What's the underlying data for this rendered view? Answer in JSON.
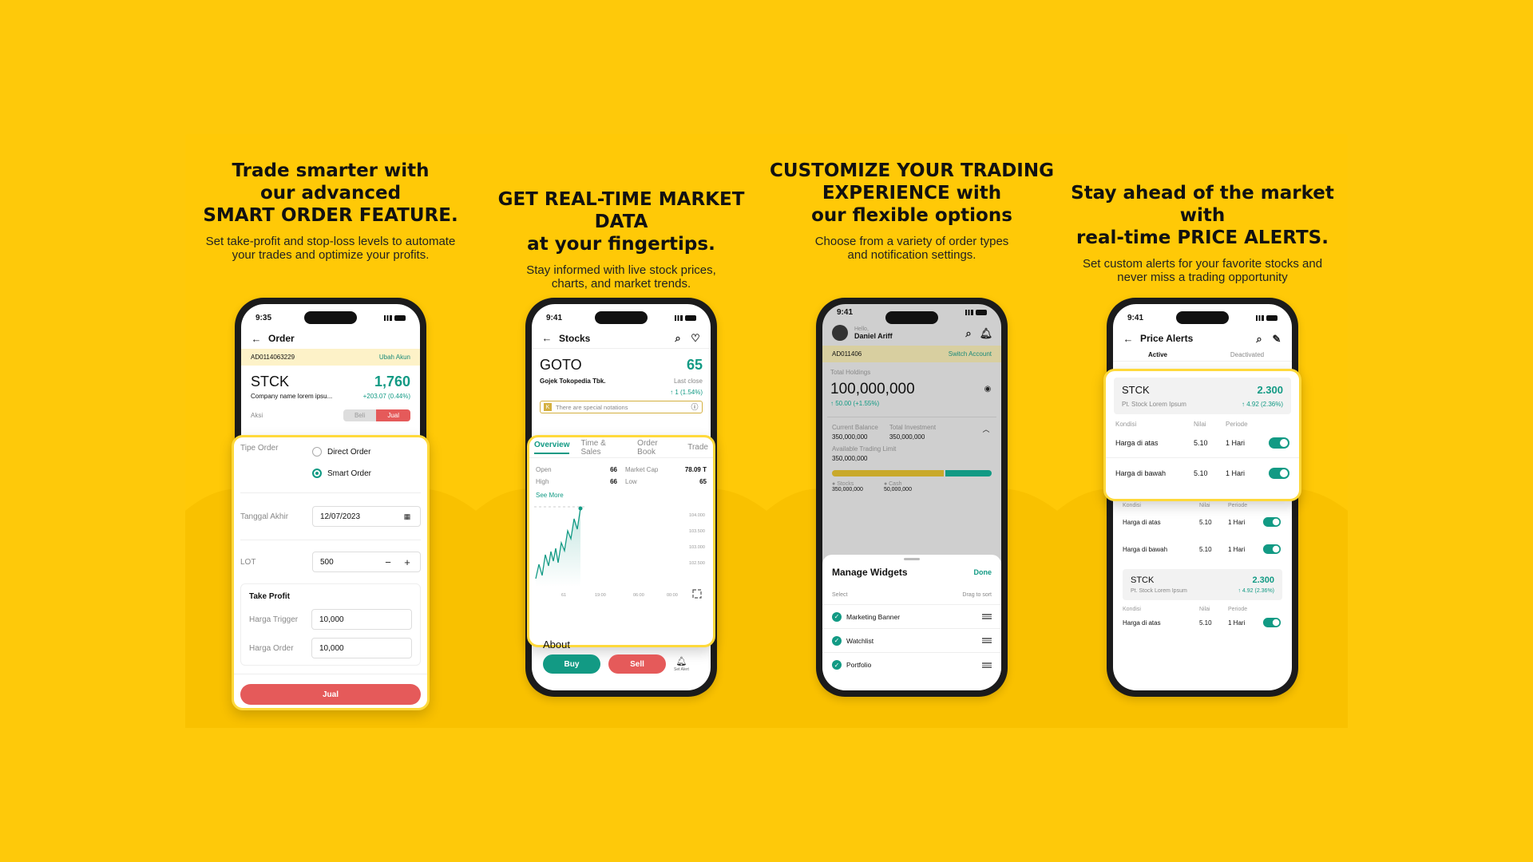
{
  "colors": {
    "background": "#FEC90A",
    "accent_green": "#129a84",
    "sell_red": "#e55a5a",
    "highlight_border": "#FFD93B"
  },
  "panels": [
    {
      "headline": "Trade smarter with\nour advanced\nSMART ORDER FEATURE.",
      "sub": "Set take-profit and stop-loss levels to automate\nyour trades and optimize your profits."
    },
    {
      "headline": "GET REAL-TIME MARKET DATA\nat your fingertips.",
      "sub": "Stay informed with live stock prices,\ncharts, and market trends."
    },
    {
      "headline": "CUSTOMIZE YOUR TRADING\nEXPERIENCE with\nour flexible options",
      "sub": "Choose from a variety of order types\nand notification settings."
    },
    {
      "headline": "Stay ahead of the market with\nreal-time PRICE ALERTS.",
      "sub": "Set custom alerts for your favorite stocks and\nnever miss a trading opportunity"
    }
  ],
  "phone1": {
    "time": "9:35",
    "title": "Order",
    "account": "AD0114063229",
    "change_account": "Ubah Akun",
    "ticker": "STCK",
    "company": "Company name lorem ipsu...",
    "price": "1,760",
    "change": "+203.07 (0.44%)",
    "aksi_label": "Aksi",
    "beli": "Beli",
    "jual": "Jual",
    "tipe_order_label": "Tipe Order",
    "direct_order": "Direct Order",
    "smart_order": "Smart Order",
    "tanggal_label": "Tanggal Akhir",
    "tanggal_value": "12/07/2023",
    "lot_label": "LOT",
    "lot_value": "500",
    "take_profit": "Take Profit",
    "harga_trigger_label": "Harga Trigger",
    "harga_trigger": "10,000",
    "harga_order_label": "Harga Order",
    "harga_order": "10,000",
    "submit": "Jual"
  },
  "phone2": {
    "time": "9:41",
    "title": "Stocks",
    "ticker": "GOTO",
    "company": "Gojek Tokopedia Tbk.",
    "price": "65",
    "last_close": "Last close",
    "change": "↑ 1 (1.54%)",
    "notice": "There are special notations",
    "tabs": [
      "Overview",
      "Time & Sales",
      "Order Book",
      "Trade"
    ],
    "stats": {
      "open_label": "Open",
      "open": "66",
      "high_label": "High",
      "high": "66",
      "mcap_label": "Market Cap",
      "mcap": "78.09 T",
      "low_label": "Low",
      "low": "65"
    },
    "see_more": "See More",
    "y_ticks": [
      "104.000",
      "103.500",
      "103.000",
      "102.500"
    ],
    "x_ticks": [
      "61",
      "19:00",
      "06:00",
      "00:00"
    ],
    "about": "About",
    "buy": "Buy",
    "sell": "Sell",
    "set_alert": "Set Alert"
  },
  "phone3": {
    "time": "9:41",
    "hello": "Hello,",
    "user": "Daniel Ariff",
    "account": "AD011406",
    "switch_account": "Switch Account",
    "total_holdings_label": "Total Holdings",
    "total_holdings": "100,000,000",
    "holdings_change": "↑ 50.00 (+1.55%)",
    "current_balance_label": "Current Balance",
    "current_balance": "350,000,000",
    "total_investment_label": "Total Investment",
    "total_investment": "350,000,000",
    "available_label": "Available Trading Limit",
    "available": "350,000,000",
    "stocks_label": "Stocks",
    "stocks_value": "350,000,000",
    "cash_label": "Cash",
    "cash_value": "50,000,000",
    "stocks_share": 0.7,
    "manage_widgets": "Manage Widgets",
    "done": "Done",
    "select": "Select",
    "drag": "Drag to sort",
    "widgets": [
      "Marketing Banner",
      "Watchlist",
      "Portfolio"
    ]
  },
  "phone4": {
    "time": "9:41",
    "title": "Price Alerts",
    "tab_active": "Active",
    "tab_deactivated": "Deactivated",
    "ticker": "STCK",
    "company": "Pt. Stock Lorem Ipsum",
    "price": "2.300",
    "change": "↑ 4.92 (2.36%)",
    "col_kondisi": "Kondisi",
    "col_nilai": "Nilai",
    "col_periode": "Periode",
    "rows": [
      {
        "kondisi": "Harga di atas",
        "nilai": "5.10",
        "periode": "1 Hari"
      },
      {
        "kondisi": "Harga di bawah",
        "nilai": "5.10",
        "periode": "1 Hari"
      }
    ]
  }
}
